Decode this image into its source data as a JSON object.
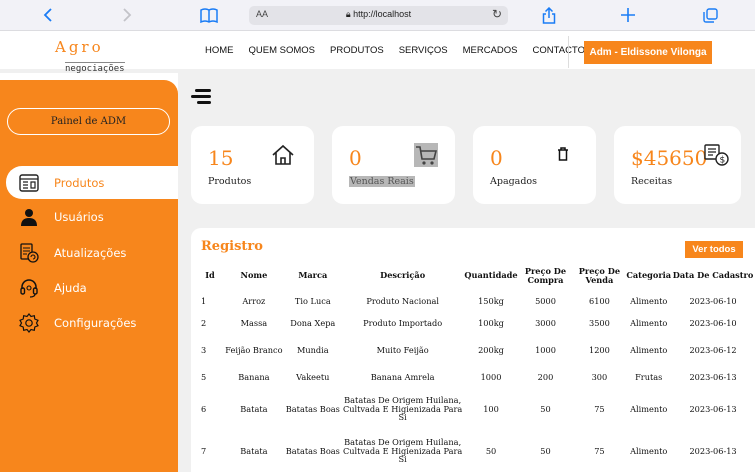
{
  "browser": {
    "url": "http://localhost",
    "text_size_label": "AA",
    "icons": [
      "back-icon",
      "forward-icon",
      "bookmarks-icon",
      "lock-icon",
      "reload-icon",
      "share-icon",
      "new-tab-icon",
      "tabs-icon"
    ]
  },
  "header": {
    "logo_top": "Agro",
    "logo_bottom": "negociações",
    "nav": [
      "HOME",
      "QUEM SOMOS",
      "PRODUTOS",
      "SERVIÇOS",
      "MERCADOS",
      "CONTACTO"
    ],
    "admin_button": "Adm - Eldissone Vilonga"
  },
  "sidebar": {
    "panel_button": "Painel de ADM",
    "items": [
      {
        "label": "Produtos",
        "icon": "products-icon",
        "active": true
      },
      {
        "label": "Usuários",
        "icon": "user-icon",
        "active": false
      },
      {
        "label": "Atualizações",
        "icon": "updates-icon",
        "active": false
      },
      {
        "label": "Ajuda",
        "icon": "headset-icon",
        "active": false
      },
      {
        "label": "Configurações",
        "icon": "gear-icon",
        "active": false
      }
    ]
  },
  "cards": [
    {
      "value": "15",
      "label": "Produtos",
      "icon": "house-icon"
    },
    {
      "value": "0",
      "label": "Vendas Reais",
      "icon": "cart-icon"
    },
    {
      "value": "0",
      "label": "Apagados",
      "icon": "trash-icon"
    },
    {
      "value": "$45650",
      "label": "Receitas",
      "icon": "money-icon"
    }
  ],
  "registro": {
    "title": "Registro",
    "view_all": "Ver todos",
    "columns": [
      "Id",
      "Nome",
      "Marca",
      "Descrição",
      "Quantidade",
      "Preço De Compra",
      "Preço De Venda",
      "Categoria",
      "Data De Cadastro"
    ],
    "rows": [
      [
        "1",
        "Arroz",
        "Tio Luca",
        "Produto Nacional",
        "150kg",
        "5000",
        "6100",
        "Alimento",
        "2023-06-10"
      ],
      [
        "2",
        "Massa",
        "Dona Xepa",
        "Produto Importado",
        "100kg",
        "3000",
        "3500",
        "Alimento",
        "2023-06-10"
      ],
      [
        "3",
        "Feijão Branco",
        "Mundia",
        "Muito Feijão",
        "200kg",
        "1000",
        "1200",
        "Alimento",
        "2023-06-12"
      ],
      [
        "5",
        "Banana",
        "Vakeetu",
        "Banana Amrela",
        "1000",
        "200",
        "300",
        "Frutas",
        "2023-06-13"
      ],
      [
        "6",
        "Batata",
        "Batatas Boas",
        "Batatas De Origem Huilana, Cultvada E Higienizada Para Si",
        "100",
        "50",
        "75",
        "Alimento",
        "2023-06-13"
      ],
      [
        "7",
        "Batata",
        "Batatas Boas",
        "Batatas De Origem Huilana, Cultvada E Higienizada Para Si",
        "50",
        "50",
        "75",
        "Alimento",
        "2023-06-13"
      ]
    ]
  },
  "colors": {
    "accent": "#f7861c",
    "browser_blue": "#1a7cf5",
    "main_bg": "#f0f0f0"
  }
}
